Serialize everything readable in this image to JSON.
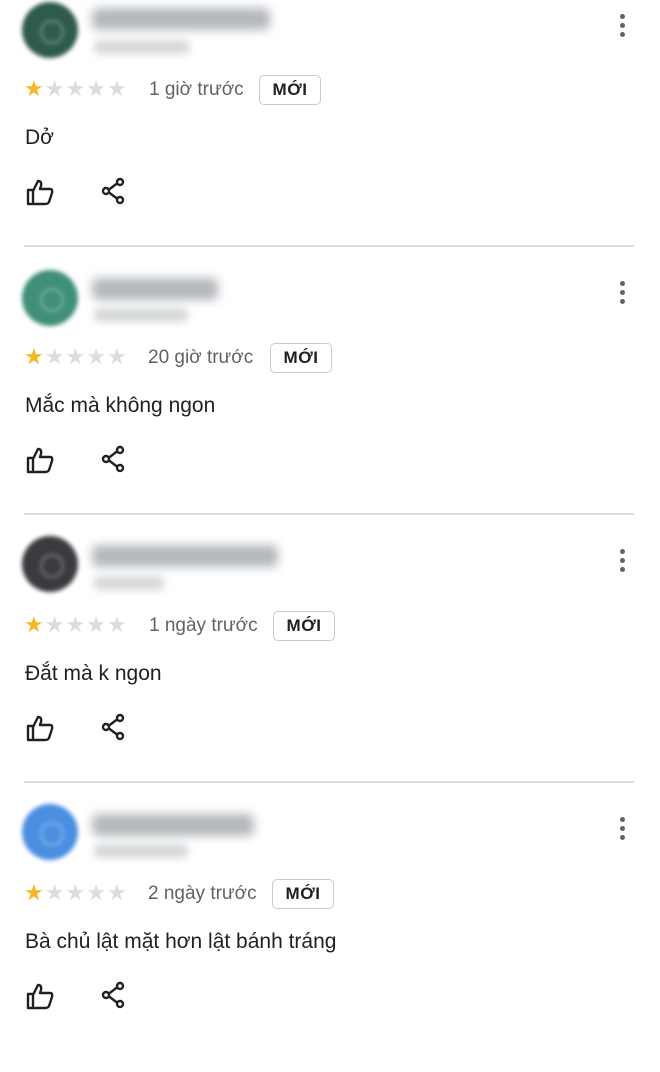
{
  "reviews": [
    {
      "avatar_color": "#2e5b4d",
      "rating": 1,
      "max_rating": 5,
      "time": "1 giờ trước",
      "badge": "MỚI",
      "text": "Dở"
    },
    {
      "avatar_color": "#3f8f7a",
      "rating": 1,
      "max_rating": 5,
      "time": "20 giờ trước",
      "badge": "MỚI",
      "text": "Mắc mà không ngon"
    },
    {
      "avatar_color": "#3b3a3f",
      "rating": 1,
      "max_rating": 5,
      "time": "1 ngày trước",
      "badge": "MỚI",
      "text": "Đắt mà k ngon"
    },
    {
      "avatar_color": "#4a8fe0",
      "rating": 1,
      "max_rating": 5,
      "time": "2 ngày trước",
      "badge": "MỚI",
      "text": "Bà chủ lật mặt hơn lật bánh tráng"
    }
  ],
  "icons": {
    "like": "thumbs-up-icon",
    "share": "share-icon",
    "more": "more-vert-icon",
    "star": "star-icon"
  },
  "colors": {
    "star_filled": "#f5b823",
    "star_empty": "#dadce0",
    "divider": "#dadce0"
  }
}
